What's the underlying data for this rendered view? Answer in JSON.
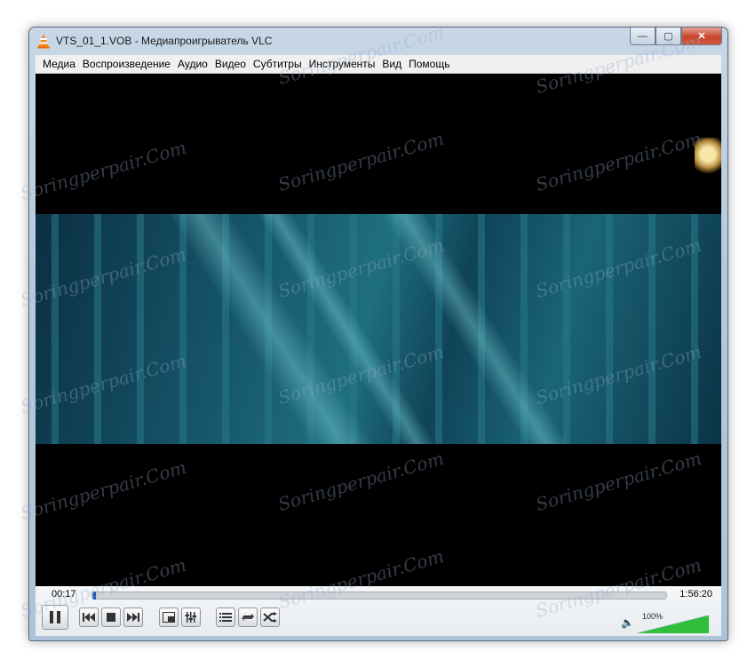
{
  "window": {
    "title": "VTS_01_1.VOB - Медиапроигрыватель VLC",
    "minimize_label": "—",
    "maximize_label": "▢",
    "close_label": "✕"
  },
  "menu": {
    "items": [
      {
        "label": "Медиа"
      },
      {
        "label": "Воспроизведение"
      },
      {
        "label": "Аудио"
      },
      {
        "label": "Видео"
      },
      {
        "label": "Субтитры"
      },
      {
        "label": "Инструменты"
      },
      {
        "label": "Вид"
      },
      {
        "label": "Помощь"
      }
    ]
  },
  "playback": {
    "current_time": "00:17",
    "total_time": "1:56:20",
    "progress_fraction": 0.0025
  },
  "volume": {
    "label": "100%",
    "level_fraction": 1.0
  },
  "icons": {
    "app": "vlc-cone-icon",
    "play_pause": "pause-icon",
    "previous": "previous-icon",
    "stop": "stop-icon",
    "next": "next-icon",
    "fullscreen": "fullscreen-icon",
    "extended": "extended-settings-icon",
    "playlist": "playlist-icon",
    "loop": "loop-icon",
    "shuffle": "shuffle-icon",
    "speaker": "speaker-icon"
  },
  "watermark_text": "Soringperpair.Com",
  "colors": {
    "accent": "#1e57b5",
    "volume_green": "#2fbf3a"
  }
}
